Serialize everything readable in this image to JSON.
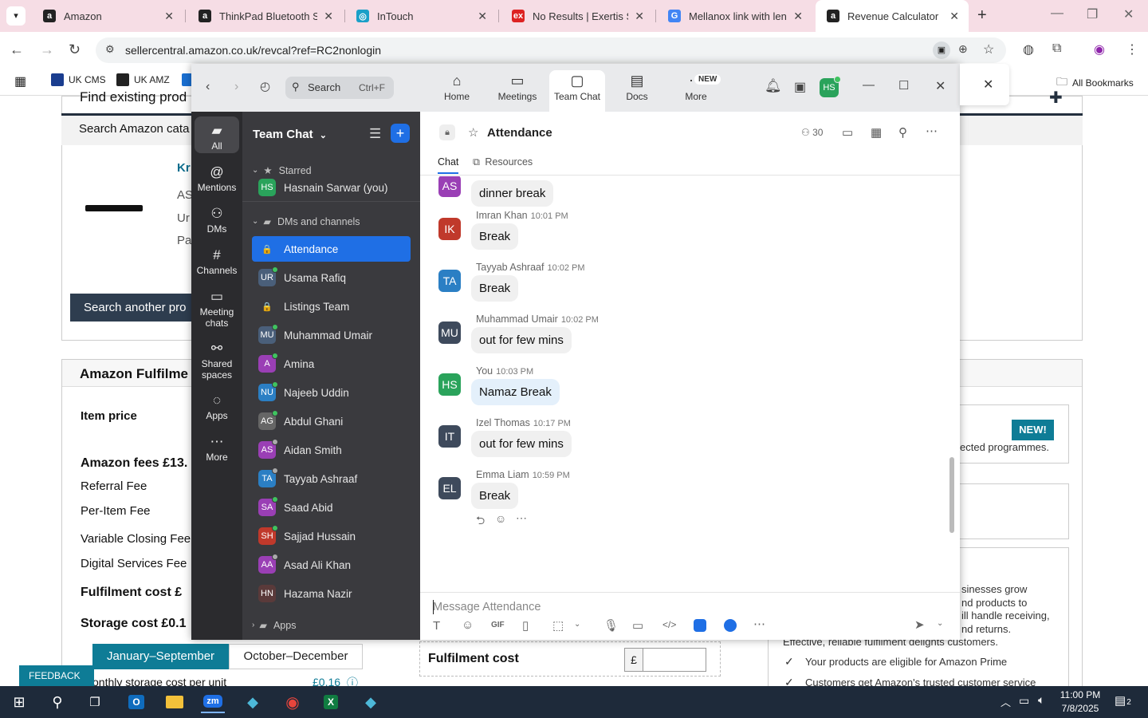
{
  "browser": {
    "tabs": [
      {
        "label": "Amazon",
        "fav": "a",
        "favcolor": "#222"
      },
      {
        "label": "ThinkPad Bluetooth Sile",
        "fav": "a",
        "favcolor": "#222"
      },
      {
        "label": "InTouch",
        "fav": "◎",
        "favcolor": "#1ba0c8"
      },
      {
        "label": "No Results | Exertis Site",
        "fav": "ex",
        "favcolor": "#d22"
      },
      {
        "label": "Mellanox link with leno",
        "fav": "G",
        "favcolor": "#4285f4"
      },
      {
        "label": "Revenue Calculator",
        "fav": "a",
        "favcolor": "#222"
      }
    ],
    "url": "sellercentral.amazon.co.uk/revcal?ref=RC2nonlogin",
    "bookmarks": [
      "UK CMS",
      "UK AMZ"
    ],
    "all_bookmarks": "All Bookmarks"
  },
  "page": {
    "find_existing": "Find existing prod",
    "search_catalog": "Search Amazon cata",
    "product_link": "Kr",
    "meta": [
      "AS",
      "Ur",
      "Pa"
    ],
    "search_another": "Search another pro",
    "fulfilment_title": "Amazon Fulfilme",
    "item_price": "Item price",
    "amazon_fees": "Amazon fees  £13.",
    "referral_fee": "Referral Fee",
    "per_item_fee": "Per-Item Fee",
    "variable_closing": "Variable Closing Fee",
    "digital_services": "Digital Services Fee",
    "fulfilment_cost": "Fulfilment cost  £",
    "storage_cost": "Storage cost  £0.1",
    "jan_sep": "January–September",
    "oct_dec": "October–December",
    "monthly_storage": "onthly storage cost per unit",
    "monthly_storage_val": "£0.16",
    "fulfilment_cost_right": "Fulfilment cost",
    "pound": "£",
    "new_badge": "NEW!",
    "selected_programmes": "ected programmes.",
    "biz_lines": [
      "sinesses grow",
      "nd products to",
      "ill handle receiving,",
      "nd returns."
    ],
    "effective": "Effective, reliable fulfilment delights customers.",
    "prime_eligible": "Your products are eligible for Amazon Prime",
    "trusted_service": "Customers get Amazon's trusted customer service",
    "feedback": "FEEDBACK"
  },
  "taskbar": {
    "time": "11:00 PM",
    "date": "7/8/2025",
    "notif_count": "2"
  },
  "zoom": {
    "search_label": "Search",
    "search_shortcut": "Ctrl+F",
    "tabs": [
      {
        "label": "Home",
        "icon": "⌂"
      },
      {
        "label": "Meetings",
        "icon": "▭"
      },
      {
        "label": "Team Chat",
        "icon": "▢"
      },
      {
        "label": "Docs",
        "icon": "▤"
      },
      {
        "label": "More",
        "icon": "⋯"
      }
    ],
    "new_badge": "NEW",
    "user_initials": "HS",
    "rail": [
      {
        "label": "All",
        "icon": "▰"
      },
      {
        "label": "Mentions",
        "icon": "@"
      },
      {
        "label": "DMs",
        "icon": "⚇"
      },
      {
        "label": "Channels",
        "icon": "#"
      },
      {
        "label": "Meeting chats",
        "icon": "▭"
      },
      {
        "label": "Shared spaces",
        "icon": "⚯"
      },
      {
        "label": "Apps",
        "icon": "◌"
      },
      {
        "label": "More",
        "icon": "⋯"
      }
    ],
    "list_title": "Team Chat",
    "starred": "Starred",
    "starred_user": {
      "initials": "HS",
      "name": "Hasnain Sarwar (you)",
      "color": "#2aa35b"
    },
    "dms_section": "DMs and channels",
    "channels": [
      {
        "initials": "🔒",
        "name": "Attendance",
        "color": "#1f6fe5",
        "dot": "",
        "lock": true
      },
      {
        "initials": "UR",
        "name": "Usama Rafiq",
        "color": "#4a5f7a",
        "dot": "#3fc35f"
      },
      {
        "initials": "🔒",
        "name": "Listings Team",
        "color": "#555",
        "dot": "",
        "lock": true
      },
      {
        "initials": "MU",
        "name": "Muhammad Umair",
        "color": "#4a5f7a",
        "dot": "#3fc35f"
      },
      {
        "initials": "A",
        "name": "Amina",
        "color": "#9a3fb5",
        "dot": "#3fc35f"
      },
      {
        "initials": "NU",
        "name": "Najeeb Uddin",
        "color": "#2b7fc4",
        "dot": "#3fc35f"
      },
      {
        "initials": "AG",
        "name": "Abdul Ghani",
        "color": "#666",
        "dot": "#3fc35f"
      },
      {
        "initials": "AS",
        "name": "Aidan Smith",
        "color": "#9a3fb5",
        "dot": "#aaa"
      },
      {
        "initials": "TA",
        "name": "Tayyab Ashraaf",
        "color": "#2b7fc4",
        "dot": "#aaa"
      },
      {
        "initials": "SA",
        "name": "Saad Abid",
        "color": "#9a3fb5",
        "dot": "#3fc35f"
      },
      {
        "initials": "SH",
        "name": "Sajjad Hussain",
        "color": "#c0392b",
        "dot": "#3fc35f"
      },
      {
        "initials": "AA",
        "name": "Asad Ali Khan",
        "color": "#9a3fb5",
        "dot": "#aaa"
      },
      {
        "initials": "HN",
        "name": "Hazama Nazir",
        "color": "#5a3a3a",
        "dot": ""
      }
    ],
    "apps_section": "Apps",
    "channel_name": "Attendance",
    "member_count": "30",
    "chat_tab": "Chat",
    "resources_tab": "Resources",
    "partial_msg": {
      "initials": "AS",
      "text": "dinner break",
      "color": "#9a3fb5"
    },
    "messages": [
      {
        "initials": "IK",
        "name": "Imran Khan",
        "time": "10:01 PM",
        "text": "Break",
        "color": "#c0392b",
        "own": false
      },
      {
        "initials": "TA",
        "name": "Tayyab Ashraaf",
        "time": "10:02 PM",
        "text": "Break",
        "color": "#2b7fc4",
        "own": false
      },
      {
        "initials": "MU",
        "name": "Muhammad Umair",
        "time": "10:02 PM",
        "text": "out for few mins",
        "color": "#3e4a5c",
        "own": false
      },
      {
        "initials": "HS",
        "name": "You",
        "time": "10:03 PM",
        "text": "Namaz Break",
        "color": "#2aa35b",
        "own": true
      },
      {
        "initials": "IT",
        "name": "Izel Thomas",
        "time": "10:17 PM",
        "text": "out for few mins",
        "color": "#3e4a5c",
        "own": false
      },
      {
        "initials": "EL",
        "name": "Emma Liam",
        "time": "10:59 PM",
        "text": "Break",
        "color": "#3e4a5c",
        "own": false
      }
    ],
    "composer_placeholder": "Message Attendance",
    "gif": "GIF"
  }
}
